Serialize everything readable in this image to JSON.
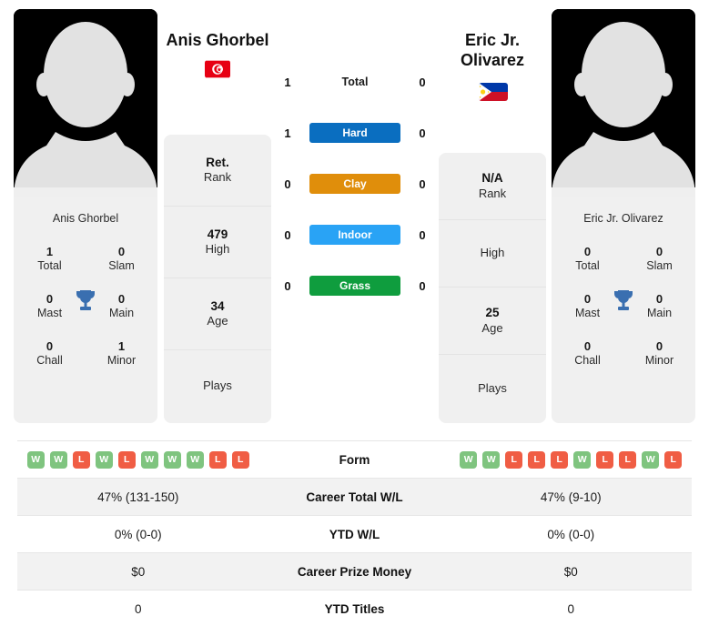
{
  "colors": {
    "hard": "#0a6ec0",
    "clay": "#e08e0b",
    "indoor": "#29a3f5",
    "grass": "#0f9d3e",
    "win": "#7fc47f",
    "loss": "#f05d44",
    "trophy": "#3a6fb0"
  },
  "players": {
    "left": {
      "name": "Anis Ghorbel",
      "photo_name": "Anis Ghorbel",
      "flag": "tunisia-flag",
      "titles": [
        {
          "value": "1",
          "label": "Total"
        },
        {
          "value": "0",
          "label": "Slam"
        },
        {
          "value": "0",
          "label": "Mast"
        },
        {
          "value": "0",
          "label": "Main"
        },
        {
          "value": "0",
          "label": "Chall"
        },
        {
          "value": "1",
          "label": "Minor"
        }
      ],
      "info": [
        {
          "value": "Ret.",
          "label": "Rank"
        },
        {
          "value": "479",
          "label": "High"
        },
        {
          "value": "34",
          "label": "Age"
        },
        {
          "value": "",
          "label": "Plays"
        }
      ],
      "surface_counts": [
        "1",
        "1",
        "0",
        "0",
        "0"
      ],
      "form": [
        "W",
        "W",
        "L",
        "W",
        "L",
        "W",
        "W",
        "W",
        "L",
        "L"
      ],
      "stats": [
        "47% (131-150)",
        "0% (0-0)",
        "$0",
        "0"
      ]
    },
    "right": {
      "name": "Eric Jr. Olivarez",
      "photo_name": "Eric Jr. Olivarez",
      "flag": "philippines-flag",
      "titles": [
        {
          "value": "0",
          "label": "Total"
        },
        {
          "value": "0",
          "label": "Slam"
        },
        {
          "value": "0",
          "label": "Mast"
        },
        {
          "value": "0",
          "label": "Main"
        },
        {
          "value": "0",
          "label": "Chall"
        },
        {
          "value": "0",
          "label": "Minor"
        }
      ],
      "info": [
        {
          "value": "N/A",
          "label": "Rank"
        },
        {
          "value": "",
          "label": "High"
        },
        {
          "value": "25",
          "label": "Age"
        },
        {
          "value": "",
          "label": "Plays"
        }
      ],
      "surface_counts": [
        "0",
        "0",
        "0",
        "0",
        "0"
      ],
      "form": [
        "W",
        "W",
        "L",
        "L",
        "L",
        "W",
        "L",
        "L",
        "W",
        "L"
      ],
      "stats": [
        "47% (9-10)",
        "0% (0-0)",
        "$0",
        "0"
      ]
    }
  },
  "surfaces": [
    {
      "label": "Total",
      "style": "plain"
    },
    {
      "label": "Hard",
      "style": "hard"
    },
    {
      "label": "Clay",
      "style": "clay"
    },
    {
      "label": "Indoor",
      "style": "indoor"
    },
    {
      "label": "Grass",
      "style": "grass"
    }
  ],
  "table_rows": [
    {
      "label": "Form"
    },
    {
      "label": "Career Total W/L"
    },
    {
      "label": "YTD W/L"
    },
    {
      "label": "Career Prize Money"
    },
    {
      "label": "YTD Titles"
    }
  ]
}
